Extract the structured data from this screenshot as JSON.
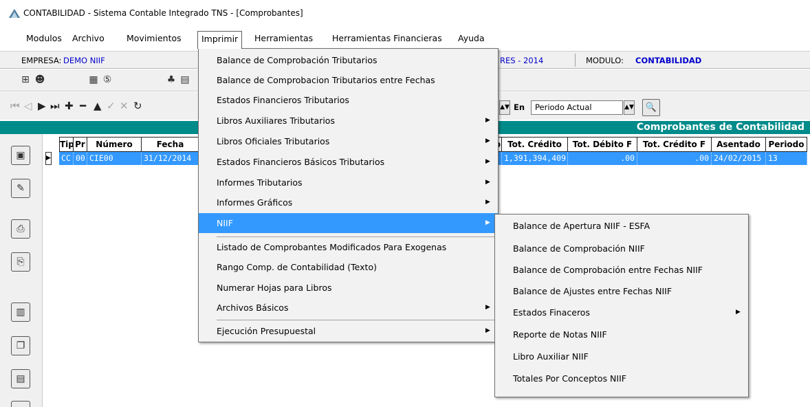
{
  "window": {
    "title": "CONTABILIDAD - Sistema Contable Integrado TNS - [Comprobantes]"
  },
  "menubar": [
    {
      "label": "Modulos"
    },
    {
      "label": "Archivo"
    },
    {
      "label": "Movimientos"
    },
    {
      "label": "Imprimir"
    },
    {
      "label": "Herramientas"
    },
    {
      "label": "Herramientas Financieras"
    },
    {
      "label": "Ayuda"
    }
  ],
  "infobar": {
    "empresa_label": "EMPRESA:",
    "empresa_value": "DEMO NIIF",
    "period_value": "RES - 2014",
    "modulo_label": "MODULO:",
    "modulo_value": "CONTABILIDAD"
  },
  "filter": {
    "en_label": "En",
    "period_select": "Periodo Actual"
  },
  "grid_title": "Comprobantes de Contabilidad",
  "grid": {
    "headers": [
      "Tip",
      "Pr",
      "Número",
      "Fecha",
      "o",
      "Tot. Crédito",
      "Tot. Débito F",
      "Tot. Crédito F",
      "Asentado",
      "Periodo"
    ],
    "row": [
      "CC",
      "00",
      "CIE00",
      "31/12/2014",
      "0",
      "1,391,394,409",
      ".00",
      ".00",
      "24/02/2015",
      "13"
    ]
  },
  "menu_imprimir": [
    "Balance de Comprobación Tributarios",
    "Balance de Comprobacion Tributarios entre Fechas",
    "Estados Financieros Tributarios",
    "Libros Auxiliares Tributarios",
    "Libros Oficiales Tributarios",
    "Estados Financieros Básicos Tributarios",
    "Informes Tributarios",
    "Informes Gráficos",
    "NIIF",
    "Listado de Comprobantes Modificados Para Exogenas",
    "Rango Comp. de Contabilidad (Texto)",
    "Numerar Hojas para Libros",
    "Archivos Básicos",
    "Ejecución Presupuestal"
  ],
  "menu_niif": [
    "Balance de Apertura NIIF - ESFA",
    "Balance de Comprobación NIIF",
    "Balance de Comprobación entre Fechas NIIF",
    "Balance de Ajustes entre Fechas NIIF",
    "Estados Finaceros",
    "Reporte de Notas NIIF",
    "Libro Auxiliar NIIF",
    "Totales Por Conceptos NIIF"
  ]
}
